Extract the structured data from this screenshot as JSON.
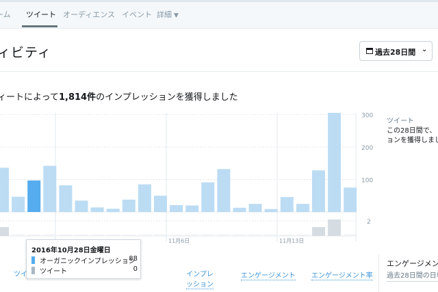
{
  "nav": {
    "tabs": [
      {
        "label": "ホーム",
        "display": "ーム"
      },
      {
        "label": "ツイート"
      },
      {
        "label": "オーディエンス"
      },
      {
        "label": "イベント"
      },
      {
        "label": "詳細"
      }
    ]
  },
  "page": {
    "title": "ィビティ",
    "date_range_button": "過去28日間",
    "summary_prefix": "ツイートによって",
    "summary_prefix_display": "ィートによって",
    "summary_count": "1,814件",
    "summary_mid": "のインプレッション",
    "summary_suffix": "を獲得しました"
  },
  "colors": {
    "bar": "#bcdcf4",
    "bar_selected": "#55acee",
    "secondary_bar": "#e1e8ed",
    "grid": "#e1e8ed",
    "link": "#3b94d9"
  },
  "chart_data": {
    "type": "bar",
    "ylim": [
      0,
      300
    ],
    "yticks": [
      "100",
      "200",
      "300"
    ],
    "secondary_ytick": "2",
    "x_tick_labels": [
      "11月6日",
      "11月13日"
    ],
    "grid": true,
    "selected_index": 2,
    "series": [
      {
        "name": "オーガニックインプレッション",
        "values": [
          136,
          47,
          97,
          142,
          82,
          35,
          14,
          10,
          38,
          85,
          50,
          21,
          20,
          91,
          132,
          13,
          25,
          9,
          46,
          25,
          128,
          305,
          75
        ]
      },
      {
        "name": "ツイート",
        "values": [
          1,
          0,
          0,
          0,
          0,
          0,
          0,
          0,
          0,
          0,
          0,
          0,
          0,
          0,
          0,
          0,
          0,
          0,
          0,
          0,
          1,
          2,
          0
        ]
      }
    ]
  },
  "side": {
    "title": "ツイート",
    "line1": "この28日間で、",
    "line2": "ョンを獲得しまし"
  },
  "tooltip": {
    "date": "2016年10月28日金曜日",
    "rows": [
      {
        "label": "オーガニックインプレッション",
        "value": "88",
        "color": "#55acee"
      },
      {
        "label": "ツイート",
        "value": "0",
        "color": "#aab8c2"
      }
    ]
  },
  "bottom_tabs": {
    "left_fragment": "ツイ",
    "impressions_1": "インプレ",
    "impressions_2": "ッション",
    "engagements": "エンゲージメント",
    "engagement_rate": "エンゲージメント率"
  },
  "engagement_panel": {
    "title": "エンゲージメン",
    "subtitle": "過去28日間の日単"
  }
}
